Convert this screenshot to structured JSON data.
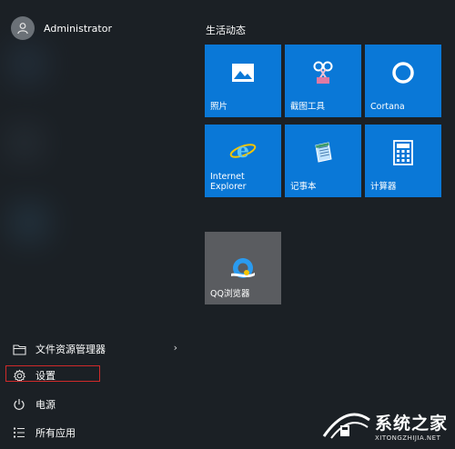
{
  "user": {
    "name": "Administrator",
    "icon": "user-icon"
  },
  "tiles_section": {
    "title": "生活动态"
  },
  "tiles": [
    {
      "label": "照片",
      "icon": "photos-icon"
    },
    {
      "label": "截图工具",
      "icon": "snipping-tool-icon"
    },
    {
      "label": "Cortana",
      "icon": "cortana-icon"
    },
    {
      "label": "Internet\nExplorer",
      "icon": "internet-explorer-icon"
    },
    {
      "label": "记事本",
      "icon": "notepad-icon"
    },
    {
      "label": "计算器",
      "icon": "calculator-icon"
    },
    {
      "label": "QQ浏览器",
      "icon": "qq-browser-icon"
    }
  ],
  "left_menu": {
    "file_explorer": {
      "label": "文件资源管理器",
      "icon": "folder-icon"
    },
    "settings": {
      "label": "设置",
      "icon": "gear-icon"
    },
    "power": {
      "label": "电源",
      "icon": "power-icon"
    },
    "all_apps": {
      "label": "所有应用",
      "icon": "list-icon"
    }
  },
  "colors": {
    "tile": "#0a78d7",
    "tile_gray": "#5a5c60",
    "highlight": "#d02a2a"
  },
  "watermark": {
    "title": "系统之家",
    "subtitle": "XITONGZHIJIA.NET"
  }
}
